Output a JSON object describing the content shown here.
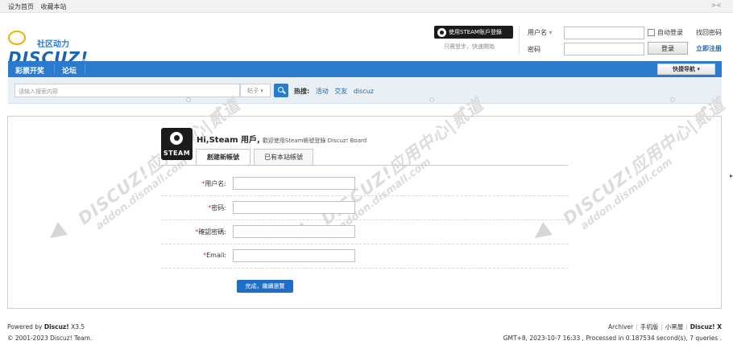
{
  "topbar": {
    "set_home": "设为首页",
    "bookmark": "收藏本站",
    "collapse": "><"
  },
  "logo": {
    "tagline": "社区动力",
    "wordmark": "DISCUZ!"
  },
  "steam_login": {
    "button_label": "使用STEAM账戶登錄",
    "tip": "只需登步，快速開始"
  },
  "login": {
    "username_label": "用户名",
    "password_label": "密码",
    "auto_login": "自动登录",
    "find_password": "找回密码",
    "login_button": "登录",
    "register": "立即注册"
  },
  "nav": {
    "items": [
      "彩票开奖",
      "论坛"
    ],
    "quick_nav": "快捷导航 ▾"
  },
  "search": {
    "placeholder": "请输入搜索内容",
    "type": "帖子 ▾",
    "hot_label": "热搜:",
    "hot_terms": [
      "活动",
      "交友",
      "discuz"
    ]
  },
  "watermark": {
    "line1": "DISCUZ!应用中心|贰道",
    "line2": "addon.dismall.com"
  },
  "steam_panel": {
    "logo_text": "STEAM",
    "greeting_name": "Hi,Steam 用戶,",
    "greeting_text": "歡迎使用Steam帳號登錄 Discuz! Board",
    "tabs": [
      "創建新帳號",
      "已有本站帳號"
    ]
  },
  "form": {
    "fields": [
      {
        "label": "用户名:"
      },
      {
        "label": "密码:"
      },
      {
        "label": "確認密碼:"
      },
      {
        "label": "Email:"
      }
    ],
    "submit": "完成，繼續瀏覽"
  },
  "footer": {
    "powered_prefix": "Powered by",
    "product": "Discuz!",
    "version": "X3.5",
    "copyright": "© 2001-2023",
    "team": "Discuz! Team.",
    "links": [
      "Archiver",
      "手机版",
      "小黑屋"
    ],
    "brand": "Discuz! X",
    "status": "GMT+8, 2023-10-7 16:33 , Processed in 0.187534 second(s), 7 queries ."
  },
  "colors": {
    "accent": "#2b7acd",
    "steam_dark": "#1b1b1b",
    "required": "#e03030"
  }
}
